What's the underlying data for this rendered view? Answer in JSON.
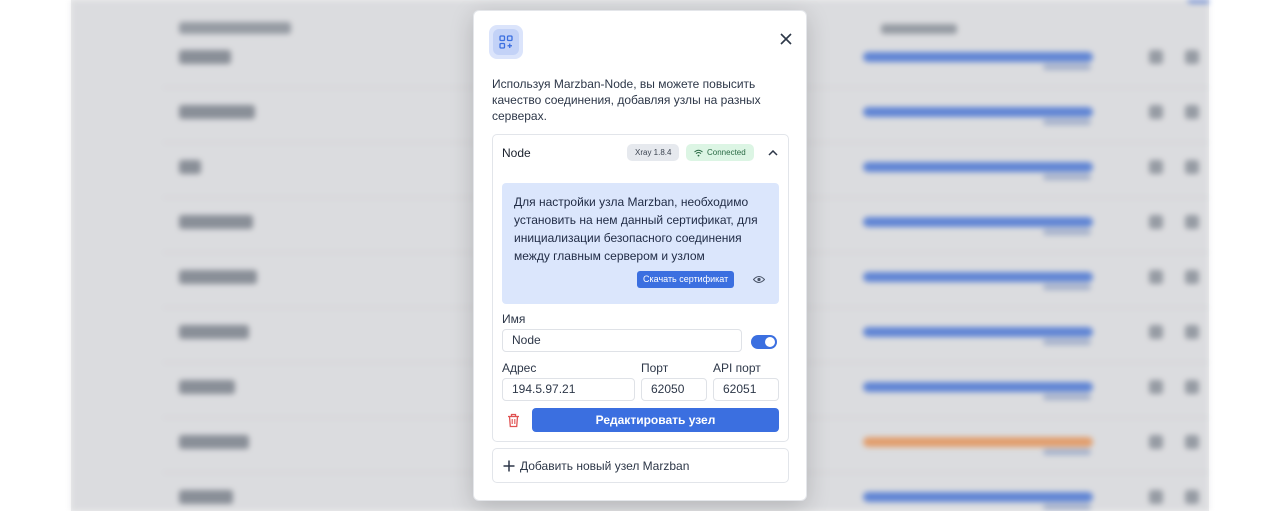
{
  "modal": {
    "intro": "Используя Marzban-Node, вы можете повысить качество соединения, добавляя узлы на разных серверах.",
    "icon": "node-grid-icon",
    "close_icon": "close-icon"
  },
  "node": {
    "title": "Node",
    "xray_badge": "Xray 1.8.4",
    "status_badge": "Connected",
    "info_text": "Для настройки узла Marzban, необходимо установить на нем данный сертификат, для инициализации безопасного соединения между главным сервером и узлом",
    "download_cert_label": "Скачать сертификат",
    "name_label": "Имя",
    "name_value": "Node",
    "address_label": "Адрес",
    "address_value": "194.5.97.21",
    "port_label": "Порт",
    "port_value": "62050",
    "api_port_label": "API порт",
    "api_port_value": "62051",
    "edit_button": "Редактировать узел",
    "enabled": true
  },
  "add_node": {
    "label": "Добавить новый узел Marzban"
  },
  "colors": {
    "accent": "#3b6fe0",
    "info_bg": "#dbe6fc",
    "connected_bg": "#dcf5e4",
    "danger": "#e05252"
  }
}
